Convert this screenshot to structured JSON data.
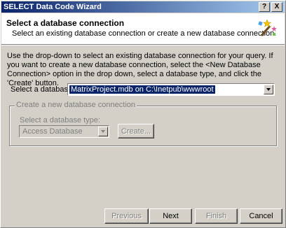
{
  "window": {
    "title": "SELECT Data Code Wizard",
    "help_btn": "?",
    "close_btn": "X"
  },
  "header": {
    "title": "Select a database connection",
    "subtitle": "Select an existing database connection or create a new database connection."
  },
  "instructions": "Use the drop-down to select an existing database connection for your query.  If you want to create a new database connection, select the <New Database Connection> option in the drop down, select a database type, and click the 'Create' button.",
  "select_db": {
    "label": "Select a database",
    "value": "MatrixProject.mdb on C:\\Inetpub\\wwwroot"
  },
  "new_conn": {
    "legend": "Create a new database connection",
    "type_label": "Select a database type:",
    "type_value": "Access Database",
    "create_button": "Create..."
  },
  "buttons": {
    "previous": "Previous",
    "next": "Next",
    "finish": "Finish",
    "cancel": "Cancel"
  }
}
